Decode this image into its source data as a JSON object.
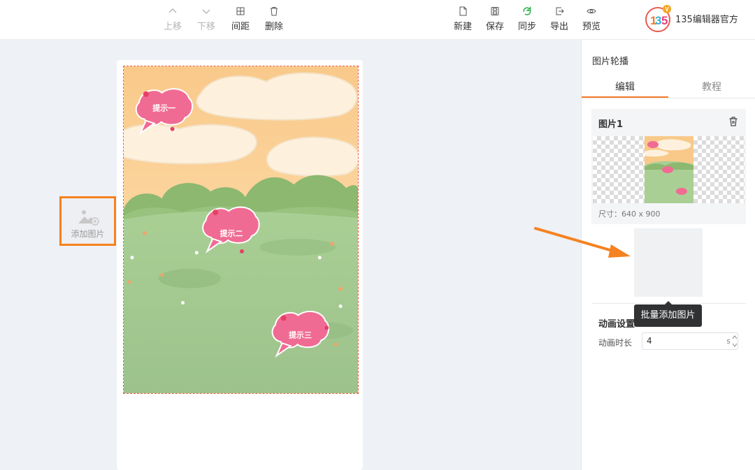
{
  "toolbar": {
    "left": [
      {
        "label": "上移",
        "icon": "chevron-up-icon",
        "disabled": true
      },
      {
        "label": "下移",
        "icon": "chevron-down-icon",
        "disabled": true
      },
      {
        "label": "间距",
        "icon": "spacing-icon",
        "disabled": false
      },
      {
        "label": "删除",
        "icon": "trash-icon",
        "disabled": false
      }
    ],
    "right": [
      {
        "label": "新建",
        "icon": "new-file-icon"
      },
      {
        "label": "保存",
        "icon": "save-icon"
      },
      {
        "label": "同步",
        "icon": "sync-icon"
      },
      {
        "label": "导出",
        "icon": "export-icon"
      },
      {
        "label": "预览",
        "icon": "eye-icon"
      }
    ],
    "brand": "135编辑器官方"
  },
  "canvas": {
    "bubbles": [
      "提示一",
      "提示二",
      "提示三"
    ]
  },
  "panel": {
    "title": "图片轮播",
    "tabs": [
      {
        "label": "编辑",
        "active": true
      },
      {
        "label": "教程",
        "active": false
      }
    ],
    "image_card": {
      "title": "图片1",
      "size": "尺寸：640 x 900"
    },
    "add_image_label": "添加图片",
    "tooltip": "批量添加图片",
    "animation": {
      "title": "动画设置",
      "duration_label": "动画时长",
      "duration_value": "4",
      "unit": "s"
    }
  },
  "colors": {
    "accent": "#f37b2a",
    "highlight_box": "#f58220",
    "dashed_border": "#f06043",
    "sync_green": "#2cb24a"
  }
}
